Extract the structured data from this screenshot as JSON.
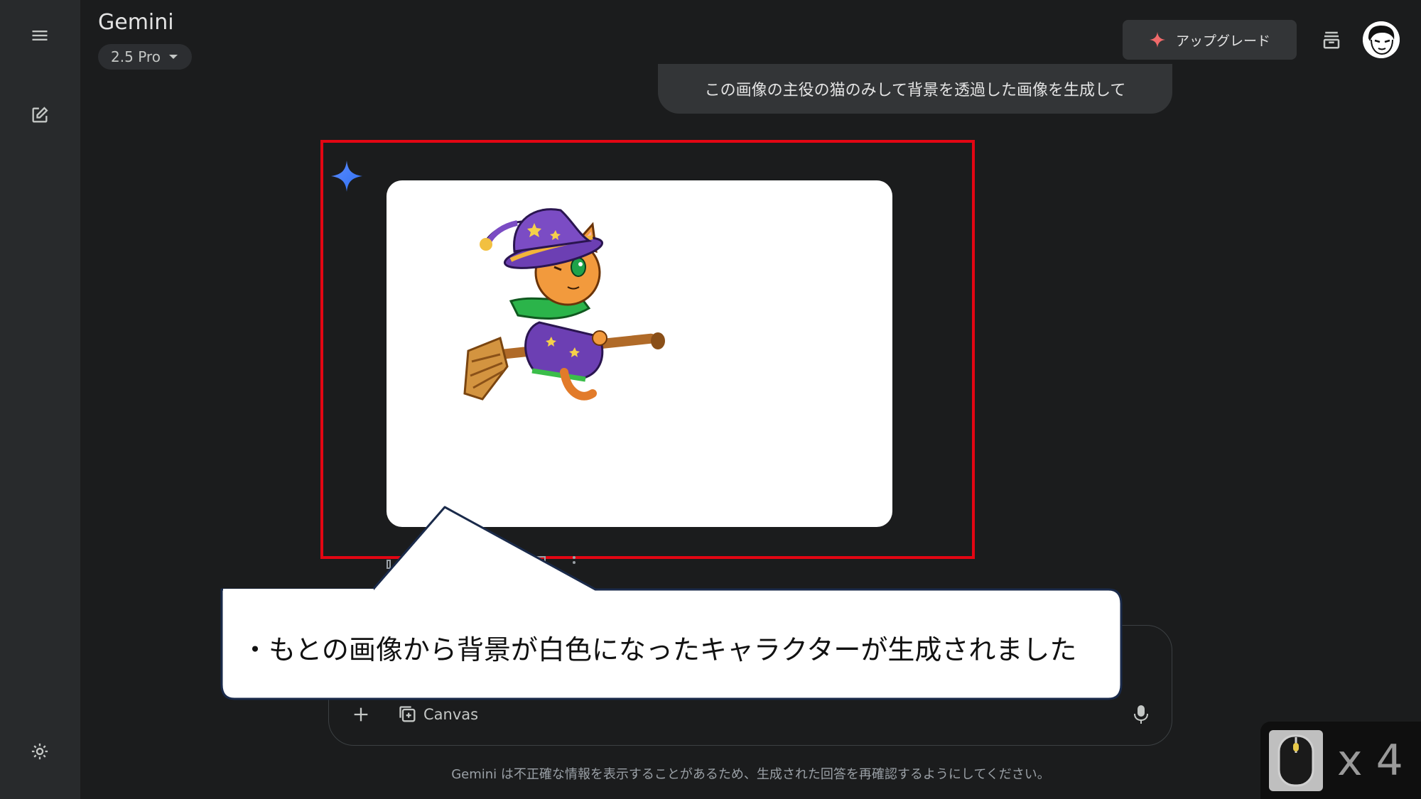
{
  "app": {
    "title": "Gemini",
    "model": "2.5 Pro"
  },
  "header": {
    "upgrade_label": "アップグレード"
  },
  "chat": {
    "user_prompt": "この画像の主役の猫のみして背景を透過した画像を生成して"
  },
  "composer": {
    "canvas_label": "Canvas"
  },
  "disclaimer": "Gemini は不正確な情報を表示することがあるため、生成された回答を再確認するようにしてください。",
  "annotation": {
    "callout_text": "・もとの画像から背景が白色になったキャラクターが生成されました",
    "click_count": "x 4"
  },
  "colors": {
    "background": "#1b1c1d",
    "sidebar": "#282a2c",
    "highlight": "#e30613",
    "gemini_blue": "#4285f4",
    "upgrade_spark": "#f06a6a"
  },
  "icons": {
    "menu": "hamburger-menu-icon",
    "new_chat": "edit-icon",
    "settings": "gear-icon",
    "archive": "archive-icon",
    "plus": "plus-icon",
    "canvas": "canvas-icon",
    "mic": "microphone-icon",
    "spark": "sparkle-icon",
    "mouse": "mouse-icon"
  }
}
